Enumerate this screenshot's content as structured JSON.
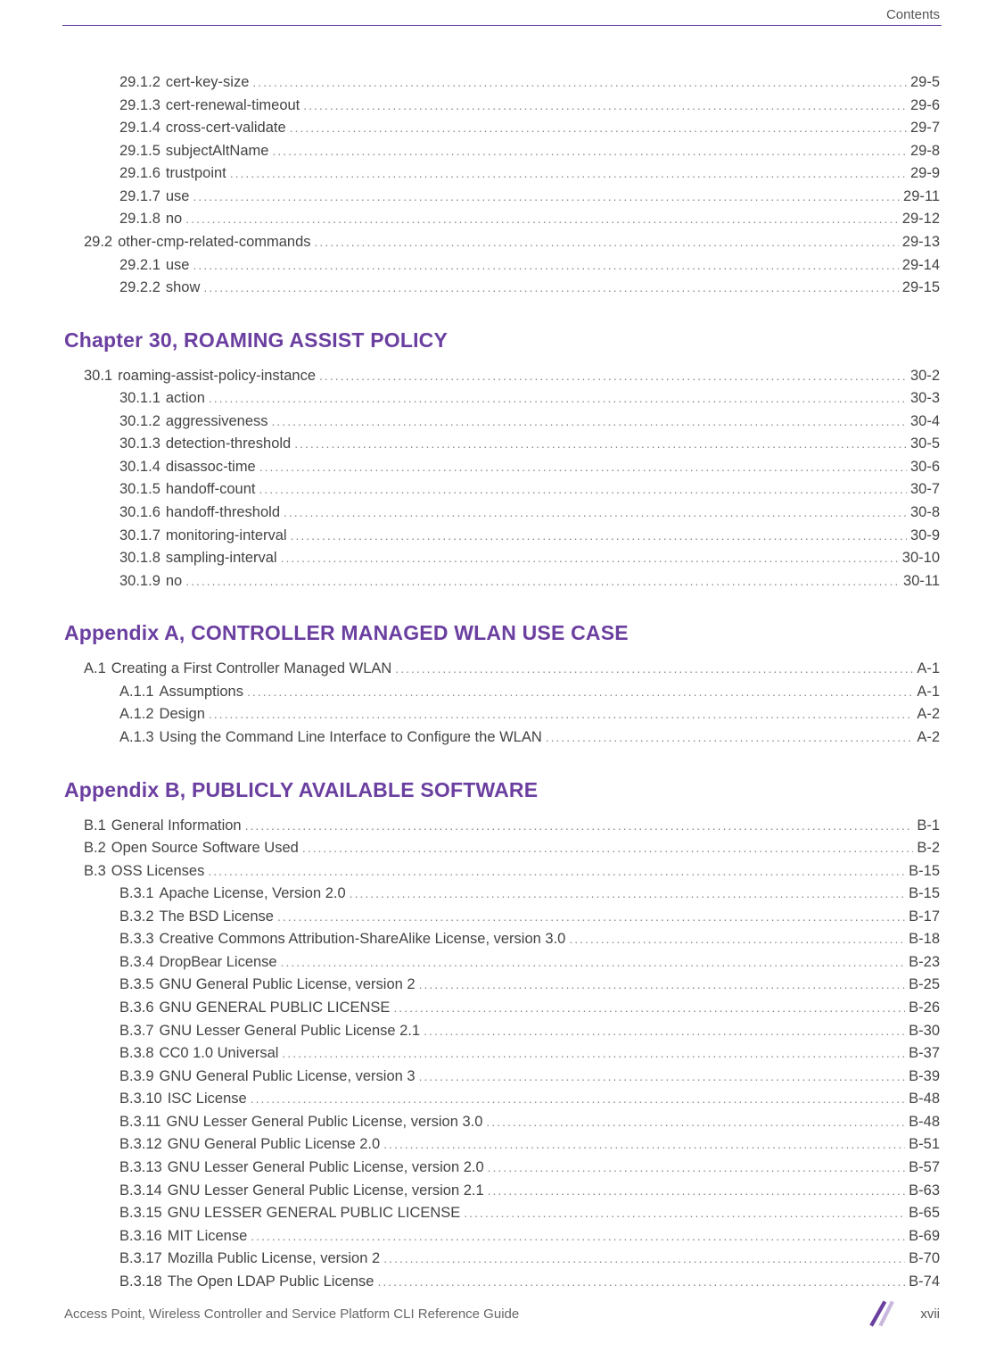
{
  "header": {
    "section": "Contents"
  },
  "footer": {
    "guide": "Access Point, Wireless Controller and Service Platform CLI Reference Guide",
    "page": "xvii"
  },
  "blocks": [
    {
      "type": "toc",
      "items": [
        {
          "lvl": 2,
          "num": "29.1.2",
          "title": "cert-key-size",
          "page": "29-5"
        },
        {
          "lvl": 2,
          "num": "29.1.3",
          "title": "cert-renewal-timeout",
          "page": "29-6"
        },
        {
          "lvl": 2,
          "num": "29.1.4",
          "title": "cross-cert-validate",
          "page": "29-7"
        },
        {
          "lvl": 2,
          "num": "29.1.5",
          "title": "subjectAltName",
          "page": "29-8"
        },
        {
          "lvl": 2,
          "num": "29.1.6",
          "title": "trustpoint",
          "page": "29-9"
        },
        {
          "lvl": 2,
          "num": "29.1.7",
          "title": "use",
          "page": "29-11"
        },
        {
          "lvl": 2,
          "num": "29.1.8",
          "title": "no",
          "page": "29-12"
        },
        {
          "lvl": 1,
          "num": "29.2",
          "title": "other-cmp-related-commands",
          "page": "29-13"
        },
        {
          "lvl": 2,
          "num": "29.2.1",
          "title": "use",
          "page": "29-14"
        },
        {
          "lvl": 2,
          "num": "29.2.2",
          "title": "show",
          "page": "29-15"
        }
      ]
    },
    {
      "type": "heading",
      "text": "Chapter 30, ROAMING ASSIST POLICY"
    },
    {
      "type": "toc",
      "items": [
        {
          "lvl": 1,
          "num": "30.1",
          "title": "roaming-assist-policy-instance",
          "page": "30-2"
        },
        {
          "lvl": 2,
          "num": "30.1.1",
          "title": "action",
          "page": "30-3"
        },
        {
          "lvl": 2,
          "num": "30.1.2",
          "title": "aggressiveness",
          "page": "30-4"
        },
        {
          "lvl": 2,
          "num": "30.1.3",
          "title": "detection-threshold",
          "page": "30-5"
        },
        {
          "lvl": 2,
          "num": "30.1.4",
          "title": "disassoc-time",
          "page": "30-6"
        },
        {
          "lvl": 2,
          "num": "30.1.5",
          "title": "handoff-count",
          "page": "30-7"
        },
        {
          "lvl": 2,
          "num": "30.1.6",
          "title": "handoff-threshold",
          "page": "30-8"
        },
        {
          "lvl": 2,
          "num": "30.1.7",
          "title": "monitoring-interval",
          "page": "30-9"
        },
        {
          "lvl": 2,
          "num": "30.1.8",
          "title": "sampling-interval",
          "page": "30-10"
        },
        {
          "lvl": 2,
          "num": "30.1.9",
          "title": "no",
          "page": "30-11"
        }
      ]
    },
    {
      "type": "heading",
      "text": "Appendix A, CONTROLLER MANAGED WLAN USE CASE"
    },
    {
      "type": "toc",
      "items": [
        {
          "lvl": 1,
          "num": "A.1",
          "title": "Creating a First Controller Managed WLAN",
          "page": "A-1"
        },
        {
          "lvl": 2,
          "num": "A.1.1",
          "title": "Assumptions",
          "page": "A-1"
        },
        {
          "lvl": 2,
          "num": "A.1.2",
          "title": "Design",
          "page": "A-2"
        },
        {
          "lvl": 2,
          "num": "A.1.3",
          "title": "Using the Command Line Interface to Configure the WLAN",
          "page": "A-2"
        }
      ]
    },
    {
      "type": "heading",
      "text": "Appendix B, PUBLICLY AVAILABLE SOFTWARE"
    },
    {
      "type": "toc",
      "items": [
        {
          "lvl": 1,
          "num": "B.1",
          "title": "General Information",
          "page": "B-1"
        },
        {
          "lvl": 1,
          "num": "B.2",
          "title": "Open Source Software Used",
          "page": "B-2"
        },
        {
          "lvl": 1,
          "num": "B.3",
          "title": " OSS Licenses",
          "page": "B-15"
        },
        {
          "lvl": 2,
          "num": "B.3.1",
          "title": "Apache License, Version 2.0",
          "page": "B-15"
        },
        {
          "lvl": 2,
          "num": "B.3.2",
          "title": "The BSD License",
          "page": "B-17"
        },
        {
          "lvl": 2,
          "num": "B.3.3",
          "title": "Creative Commons Attribution-ShareAlike License, version 3.0",
          "page": "B-18"
        },
        {
          "lvl": 2,
          "num": "B.3.4",
          "title": "DropBear License",
          "page": "B-23"
        },
        {
          "lvl": 2,
          "num": "B.3.5",
          "title": "GNU General Public License, version 2",
          "page": "B-25"
        },
        {
          "lvl": 2,
          "num": "B.3.6",
          "title": "GNU GENERAL PUBLIC LICENSE",
          "page": "B-26"
        },
        {
          "lvl": 2,
          "num": "B.3.7",
          "title": "GNU Lesser General Public License 2.1",
          "page": "B-30"
        },
        {
          "lvl": 2,
          "num": "B.3.8",
          "title": "CC0 1.0 Universal",
          "page": "B-37"
        },
        {
          "lvl": 2,
          "num": "B.3.9",
          "title": "GNU General Public License, version 3",
          "page": "B-39"
        },
        {
          "lvl": 2,
          "num": "B.3.10",
          "title": "ISC License",
          "page": "B-48"
        },
        {
          "lvl": 2,
          "num": "B.3.11",
          "title": "GNU Lesser General Public License, version 3.0",
          "page": "B-48"
        },
        {
          "lvl": 2,
          "num": "B.3.12",
          "title": " GNU General Public License 2.0",
          "page": "B-51"
        },
        {
          "lvl": 2,
          "num": "B.3.13",
          "title": "GNU Lesser General Public License, version 2.0",
          "page": "B-57"
        },
        {
          "lvl": 2,
          "num": "B.3.14",
          "title": "GNU Lesser General Public License, version 2.1",
          "page": "B-63"
        },
        {
          "lvl": 2,
          "num": "B.3.15",
          "title": "GNU LESSER GENERAL PUBLIC LICENSE",
          "page": "B-65"
        },
        {
          "lvl": 2,
          "num": "B.3.16",
          "title": "MIT License",
          "page": "B-69"
        },
        {
          "lvl": 2,
          "num": "B.3.17",
          "title": "Mozilla Public License, version 2",
          "page": "B-70"
        },
        {
          "lvl": 2,
          "num": "B.3.18",
          "title": "The Open LDAP Public License",
          "page": "B-74"
        }
      ]
    }
  ]
}
